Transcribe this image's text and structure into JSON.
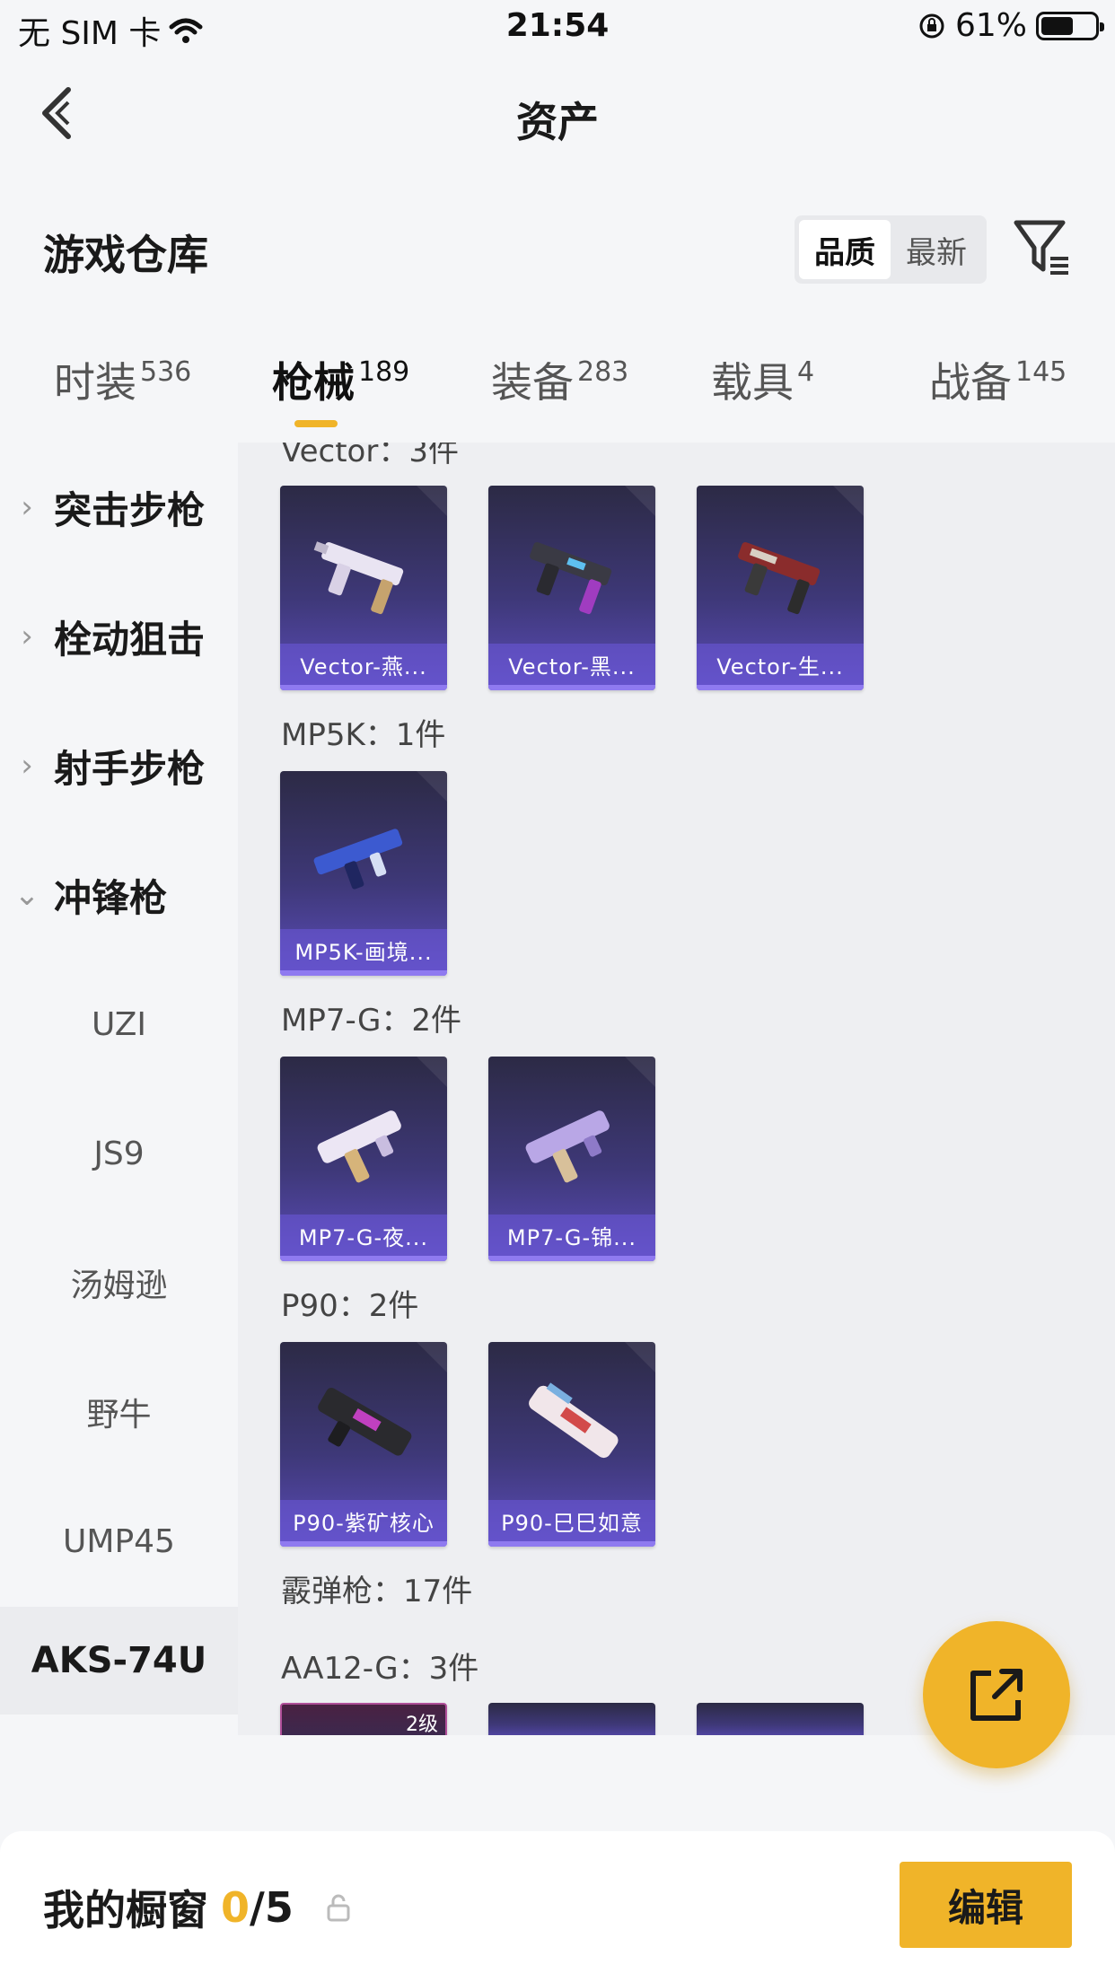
{
  "status_bar": {
    "carrier": "无 SIM 卡",
    "time": "21:54",
    "battery": "61%",
    "battery_level": 0.61
  },
  "nav": {
    "title": "资产"
  },
  "warehouse": {
    "title": "游戏仓库",
    "sort_options": [
      "品质",
      "最新"
    ],
    "sort_selected": "品质"
  },
  "tabs": [
    {
      "label": "时装",
      "count": "536"
    },
    {
      "label": "枪械",
      "count": "189"
    },
    {
      "label": "装备",
      "count": "283"
    },
    {
      "label": "载具",
      "count": "4"
    },
    {
      "label": "战备",
      "count": "145"
    }
  ],
  "active_tab": "枪械",
  "sidebar": {
    "categories": [
      "突击步枪",
      "栓动狙击",
      "射手步枪",
      "冲锋枪"
    ],
    "subitems": [
      "UZI",
      "JS9",
      "汤姆逊",
      "野牛",
      "UMP45",
      "AKS-74U"
    ],
    "active_subitem": "AKS-74U"
  },
  "groups": [
    {
      "title": "Vector：3件",
      "items": [
        "Vector-燕...",
        "Vector-黑...",
        "Vector-生..."
      ]
    },
    {
      "title": "MP5K：1件",
      "items": [
        "MP5K-画境..."
      ]
    },
    {
      "title": "MP7-G：2件",
      "items": [
        "MP7-G-夜...",
        "MP7-G-锦..."
      ]
    },
    {
      "title": "P90：2件",
      "items": [
        "P90-紫矿核心",
        "P90-巳巳如意"
      ]
    },
    {
      "title": "霰弹枪：17件",
      "items": []
    },
    {
      "title": "AA12-G：3件",
      "items": [],
      "level_badge": "2级"
    }
  ],
  "showcase": {
    "label": "我的橱窗",
    "count": "0",
    "total": "/5"
  },
  "edit_button": "编辑",
  "colors": {
    "accent": "#f0b429",
    "card_top": "#2c2a45",
    "card_bottom": "#5b4cb9"
  },
  "icons": [
    "back-arrow-icon",
    "filter-icon",
    "share-icon",
    "lock-icon",
    "wifi-icon",
    "rotation-lock-icon",
    "gun-icon"
  ]
}
